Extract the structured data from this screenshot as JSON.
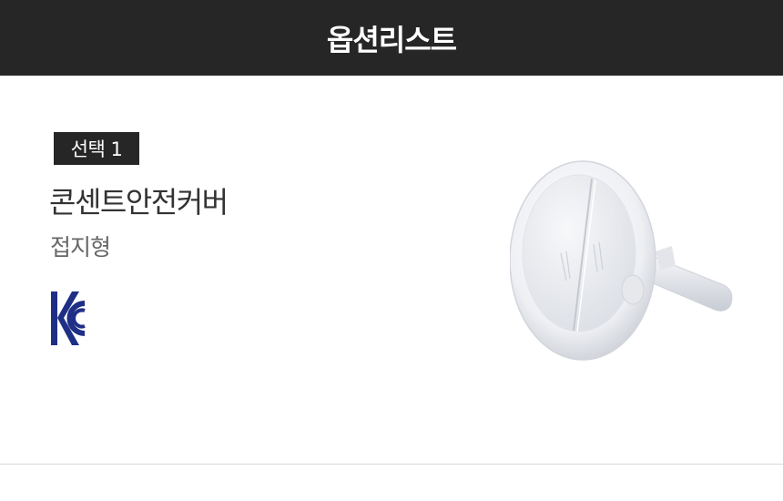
{
  "header": {
    "title": "옵션리스트"
  },
  "option": {
    "badge_label": "선택 1",
    "product_name": "콘센트안전커버",
    "variant": "접지형",
    "certification_mark": "kc-certification-mark",
    "product_image": "outlet-safety-cover-image"
  },
  "colors": {
    "header_bg": "#262626",
    "badge_bg": "#262626",
    "kc_blue": "#1f2f86",
    "divider": "#d9d9d9"
  }
}
